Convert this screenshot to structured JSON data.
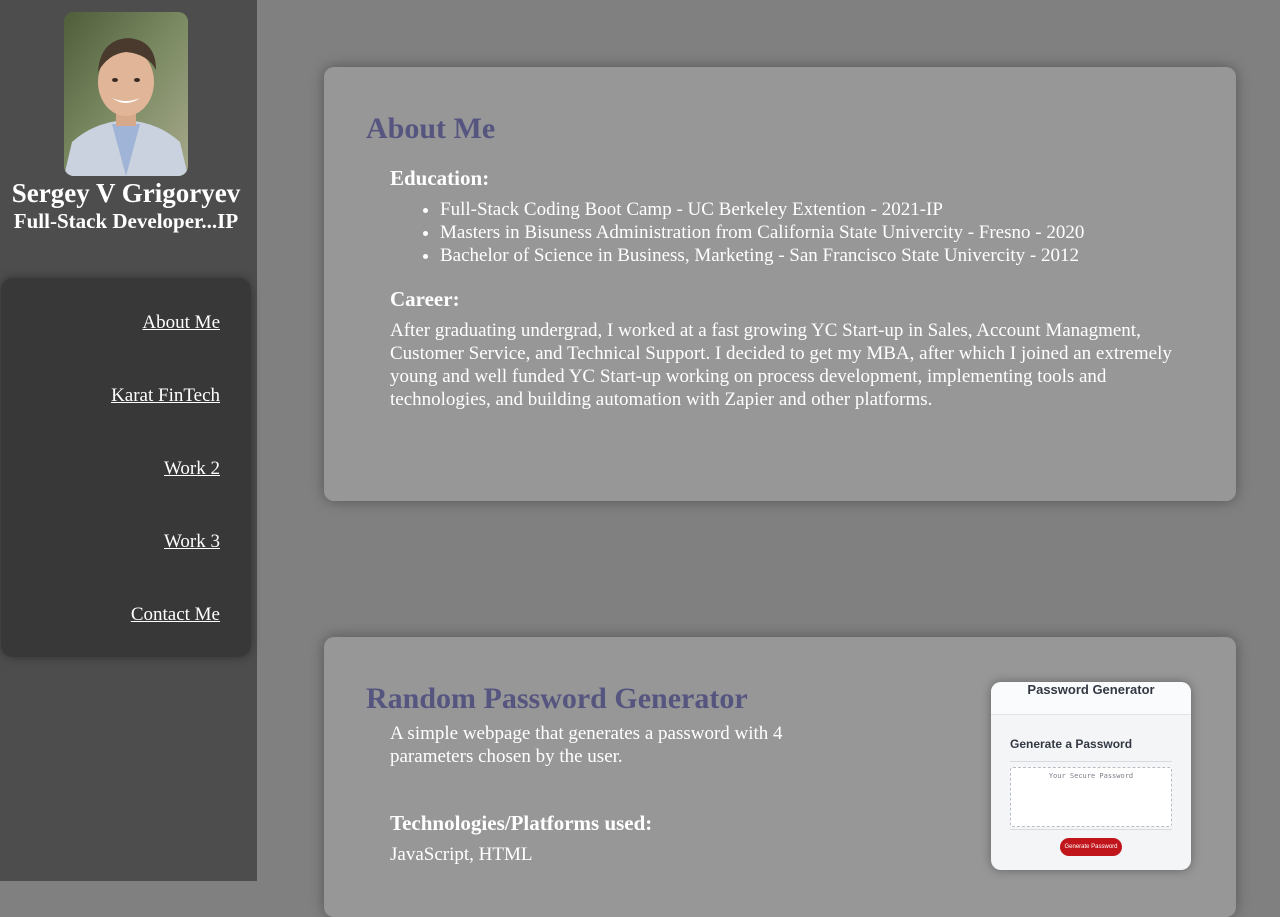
{
  "sidebar": {
    "name": "Sergey V Grigoryev",
    "role": "Full-Stack Developer...IP",
    "nav": [
      {
        "label": "About Me"
      },
      {
        "label": "Karat FinTech"
      },
      {
        "label": "Work 2"
      },
      {
        "label": "Work 3"
      },
      {
        "label": "Contact Me"
      }
    ]
  },
  "about": {
    "title": "About Me",
    "education_heading": "Education:",
    "education": [
      "Full-Stack Coding Boot Camp - UC Berkeley Extention - 2021-IP",
      "Masters in Bisuness Administration from California State Univercity - Fresno - 2020",
      "Bachelor of Science in Business, Marketing - San Francisco State Univercity - 2012"
    ],
    "career_heading": "Career:",
    "career_text": "After graduating undergrad, I worked at a fast growing YC Start-up in Sales, Account Managment, Customer Service, and Technical Support. I decided to get my MBA, after which I joined an extremely young and well funded YC Start-up working on process development, implementing tools and technologies, and building automation with Zapier and other platforms."
  },
  "project": {
    "title": "Random Password Generator",
    "description": "A simple webpage that generates a password with 4 parameters chosen by the user.",
    "tech_heading": "Technologies/Platforms used:",
    "tech": "JavaScript, HTML",
    "screenshot": {
      "title": "Password Generator",
      "subtitle": "Generate a Password",
      "placeholder": "Your Secure Password",
      "button": "Generate Password"
    }
  },
  "colors": {
    "background": "#808080",
    "sidebar": "#4d4d4d",
    "nav_panel": "#383838",
    "card": "#979797",
    "heading_accent": "#555580",
    "button_red": "#c0161b"
  }
}
